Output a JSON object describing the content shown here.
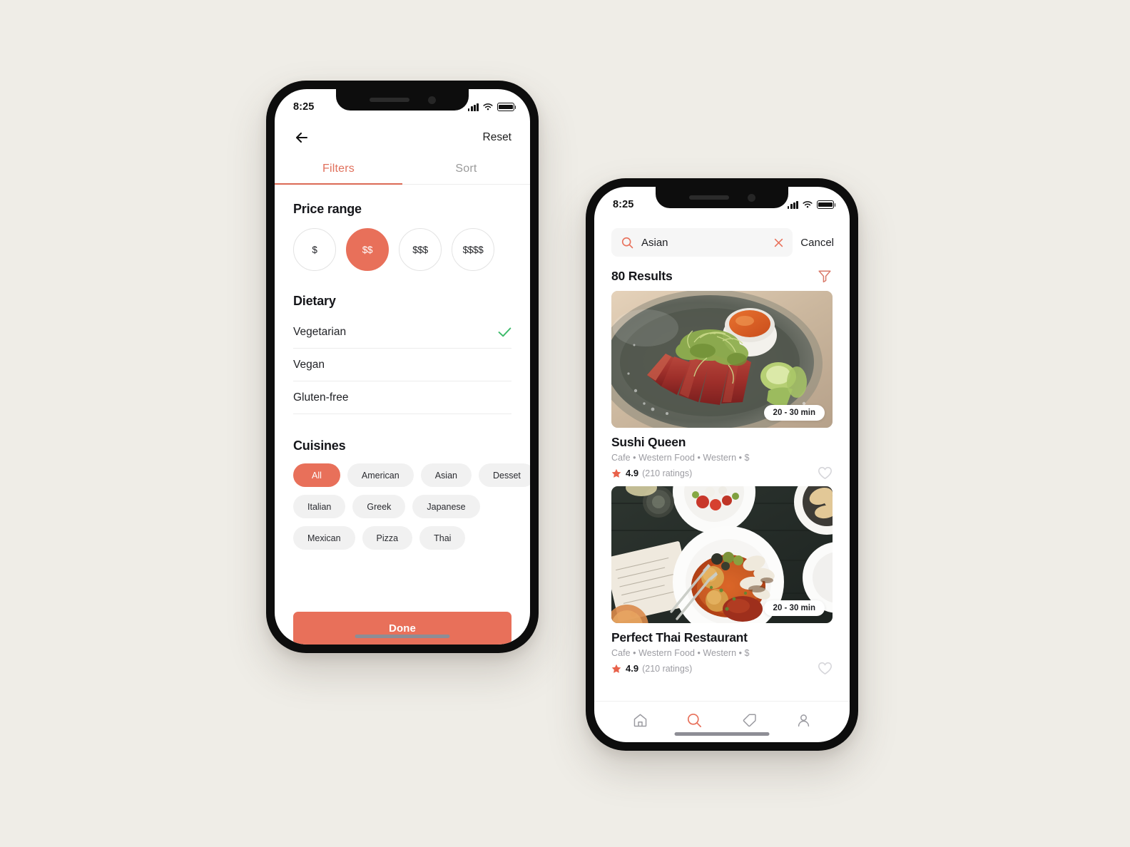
{
  "theme": {
    "page_background": "#EFEDE7",
    "accent": "#E8705A",
    "accent_text": "#E0705C",
    "check_green": "#3DBB6A",
    "muted_text": "#9C9CA2"
  },
  "filters_screen": {
    "status_bar": {
      "time": "8:25",
      "signal_icon": "cellular-signal-icon",
      "wifi_icon": "wifi-icon",
      "battery_icon": "battery-full-icon"
    },
    "top_bar": {
      "back_icon": "arrow-left-icon",
      "reset_label": "Reset"
    },
    "tabs": [
      {
        "label": "Filters",
        "active": true
      },
      {
        "label": "Sort",
        "active": false
      }
    ],
    "price_range": {
      "title": "Price range",
      "options": [
        {
          "label": "$",
          "selected": false
        },
        {
          "label": "$$",
          "selected": true
        },
        {
          "label": "$$$",
          "selected": false
        },
        {
          "label": "$$$$",
          "selected": false
        }
      ]
    },
    "dietary": {
      "title": "Dietary",
      "options": [
        {
          "label": "Vegetarian",
          "checked": true
        },
        {
          "label": "Vegan",
          "checked": false
        },
        {
          "label": "Gluten-free",
          "checked": false
        }
      ]
    },
    "cuisines": {
      "title": "Cuisines",
      "rows": [
        [
          {
            "label": "All",
            "selected": true
          },
          {
            "label": "American",
            "selected": false
          },
          {
            "label": "Asian",
            "selected": false
          },
          {
            "label": "Desset",
            "selected": false
          }
        ],
        [
          {
            "label": "Italian",
            "selected": false
          },
          {
            "label": "Greek",
            "selected": false
          },
          {
            "label": "Japanese",
            "selected": false
          }
        ],
        [
          {
            "label": "Mexican",
            "selected": false
          },
          {
            "label": "Pizza",
            "selected": false
          },
          {
            "label": "Thai",
            "selected": false
          }
        ]
      ]
    },
    "done_button": {
      "label": "Done"
    }
  },
  "search_screen": {
    "status_bar": {
      "time": "8:25",
      "signal_icon": "cellular-signal-icon",
      "wifi_icon": "wifi-icon",
      "battery_icon": "battery-full-icon"
    },
    "search": {
      "icon": "search-icon",
      "value": "Asian",
      "placeholder": "Search",
      "clear_icon": "close-x-icon",
      "cancel_label": "Cancel"
    },
    "results_header": {
      "count_label": "80 Results",
      "filter_icon": "funnel-filter-icon"
    },
    "results": [
      {
        "name": "Sushi Queen",
        "tags": "Cafe • Western Food • Western • $",
        "delivery_time": "20 - 30 min",
        "rating": "4.9",
        "ratings_count": "(210 ratings)",
        "photo": "seared-tuna-sashimi-on-dark-plate",
        "favorite_icon": "heart-outline-icon"
      },
      {
        "name": "Perfect Thai Restaurant",
        "tags": "Cafe • Western Food • Western • $",
        "delivery_time": "20 - 30 min",
        "rating": "4.9",
        "ratings_count": "(210 ratings)",
        "photo": "overhead-table-with-white-plates",
        "favorite_icon": "heart-outline-icon"
      }
    ],
    "tab_bar": [
      {
        "icon": "home-icon",
        "active": false
      },
      {
        "icon": "search-icon",
        "active": true
      },
      {
        "icon": "tag-offers-icon",
        "active": false
      },
      {
        "icon": "person-profile-icon",
        "active": false
      }
    ]
  }
}
